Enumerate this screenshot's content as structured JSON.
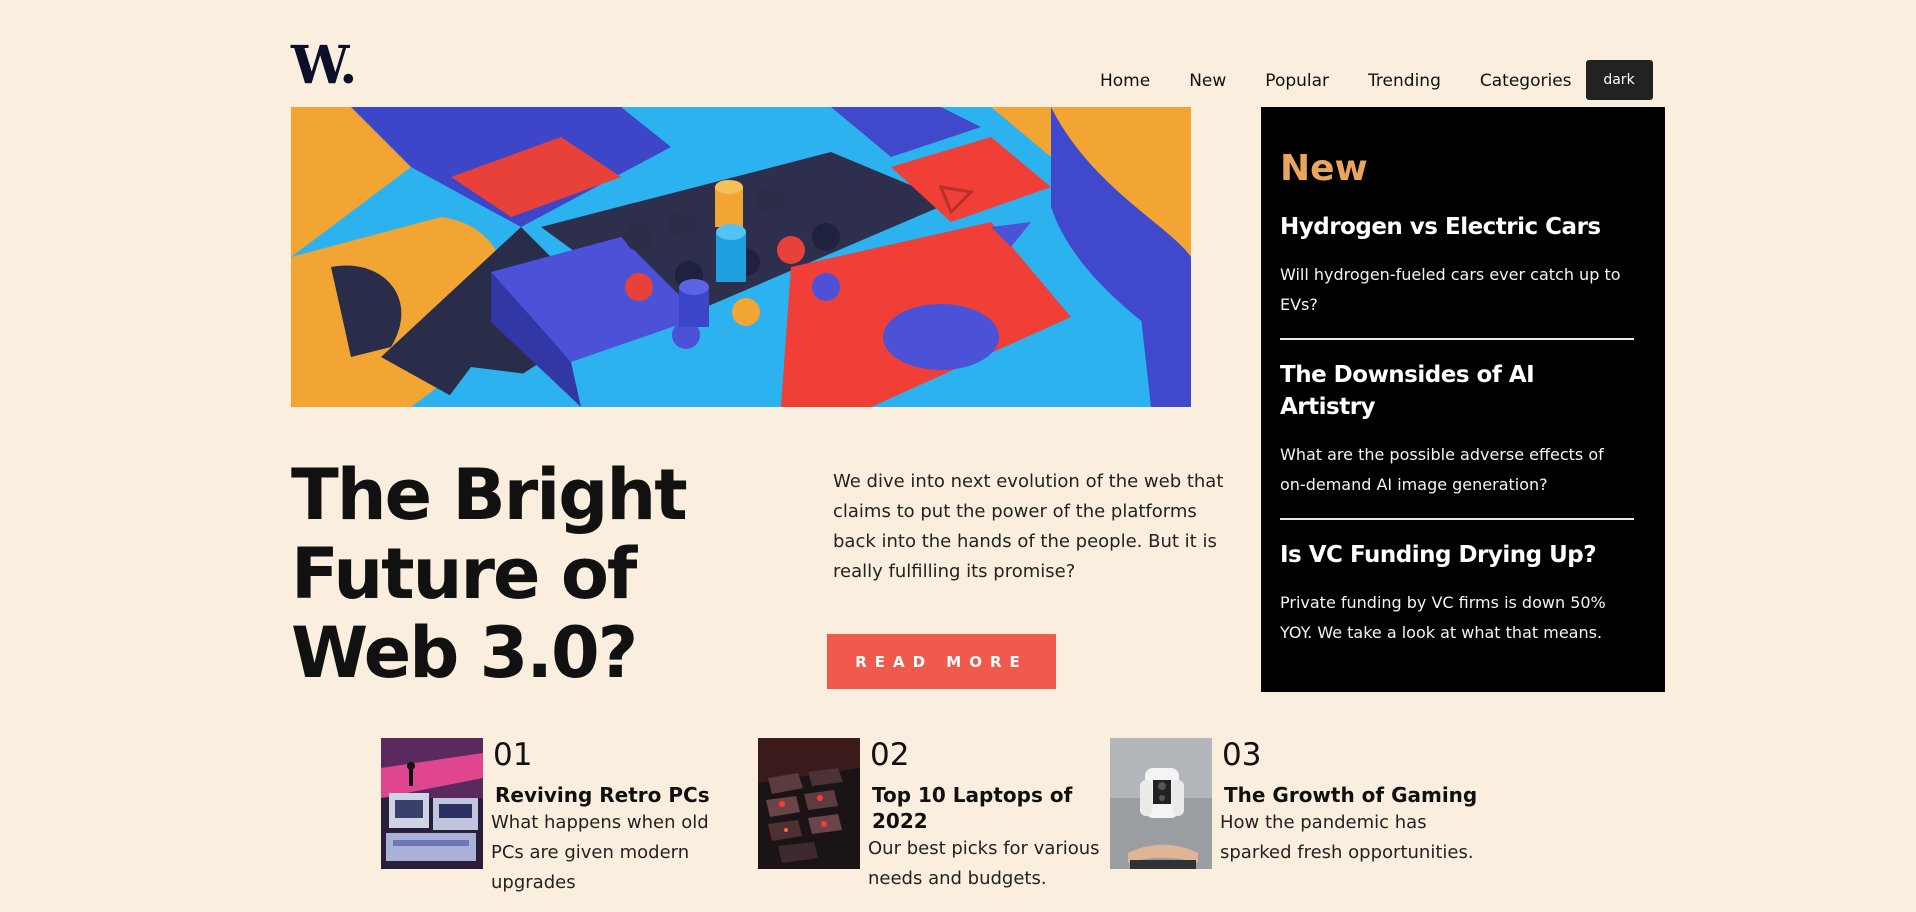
{
  "brand": {
    "logo_text": "W."
  },
  "nav": {
    "items": [
      "Home",
      "New",
      "Popular",
      "Trending",
      "Categories"
    ],
    "theme_toggle_label": "dark"
  },
  "hero": {
    "title": "The Bright Future of Web 3.0?",
    "lede": "We dive into next evolution of the web that claims to put the power of the platforms back into the hands of the people. But it is really fulfilling its promise?",
    "cta_label": "READ MORE"
  },
  "sidebar": {
    "heading": "New",
    "items": [
      {
        "title": "Hydrogen vs Electric Cars",
        "summary": "Will hydrogen-fueled cars ever catch up to EVs?"
      },
      {
        "title": "The Downsides of AI Artistry",
        "summary": "What are the possible adverse effects of on-demand AI image generation?"
      },
      {
        "title": "Is VC Funding Drying Up?",
        "summary": "Private funding by VC firms is down 50% YOY. We take a look at what that means."
      }
    ]
  },
  "featured": [
    {
      "number": "01",
      "title": "Reviving Retro PCs",
      "desc": "What happens when old PCs are given modern upgrades"
    },
    {
      "number": "02",
      "title": "Top 10 Laptops of 2022",
      "desc": "Our best picks for various needs and budgets."
    },
    {
      "number": "03",
      "title": "The Growth of Gaming",
      "desc": "How the pandemic has sparked fresh opportunities."
    }
  ],
  "colors": {
    "background": "#faefdf",
    "accent_orange": "#e9a55a",
    "cta_red": "#f05a4d",
    "sidebar_bg": "#000000"
  }
}
